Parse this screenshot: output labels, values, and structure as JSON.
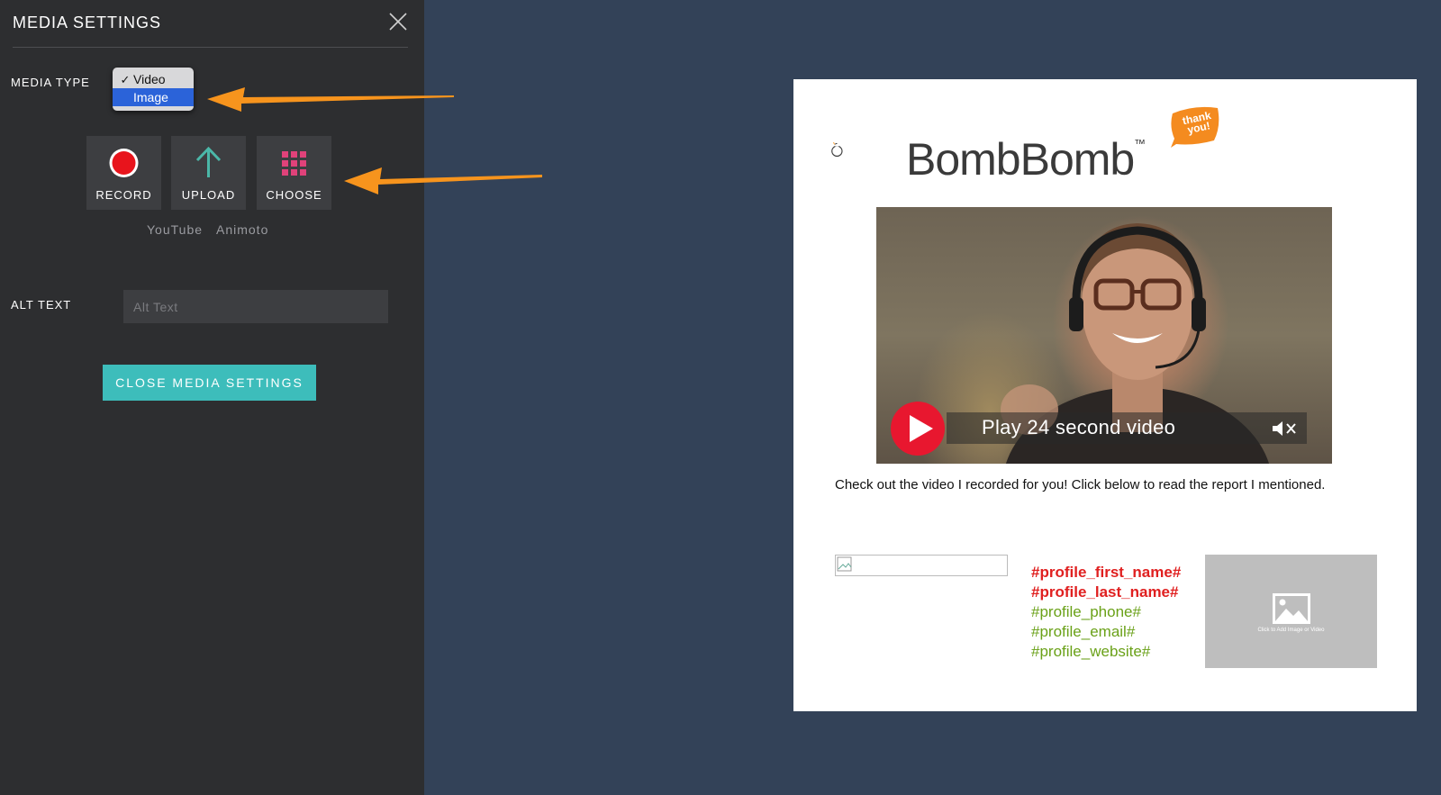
{
  "sidebar": {
    "title": "MEDIA SETTINGS",
    "media_type_label": "MEDIA TYPE",
    "media_type_options": [
      {
        "label": "Video",
        "checked": true
      },
      {
        "label": "Image",
        "highlighted": true
      }
    ],
    "buttons": {
      "record": "RECORD",
      "upload": "UPLOAD",
      "choose": "CHOOSE"
    },
    "links": {
      "youtube": "YouTube",
      "animoto": "Animoto"
    },
    "alt_text_label": "ALT TEXT",
    "alt_text_placeholder": "Alt Text",
    "close_button": "CLOSE MEDIA SETTINGS"
  },
  "email": {
    "logo_text": "BombBomb",
    "logo_tm": "™",
    "badge_text": "thank you!",
    "video": {
      "play_text": "Play 24 second video"
    },
    "body_text": "Check out the video I recorded for you! Click below to read the report I mentioned.",
    "signature": {
      "first_name": "#profile_first_name#",
      "last_name": "#profile_last_name#",
      "phone": "#profile_phone#",
      "email": "#profile_email#",
      "website": "#profile_website#"
    },
    "image_drop_label": "Click to Add Image or Video"
  },
  "colors": {
    "sidebar_bg": "#2d2e30",
    "page_bg": "#334258",
    "accent_teal": "#3dbdbb",
    "arrow_orange": "#f7941d",
    "record_red": "#e8141c",
    "upload_teal": "#4bb7a8",
    "choose_pink": "#e0427a",
    "sig_red": "#e02020",
    "sig_green": "#6aa118"
  },
  "icons": {
    "close": "close-icon",
    "record": "record-icon",
    "upload": "arrow-up-icon",
    "choose": "grid-icon",
    "play": "play-icon",
    "mute": "mute-icon",
    "picture": "picture-icon"
  }
}
